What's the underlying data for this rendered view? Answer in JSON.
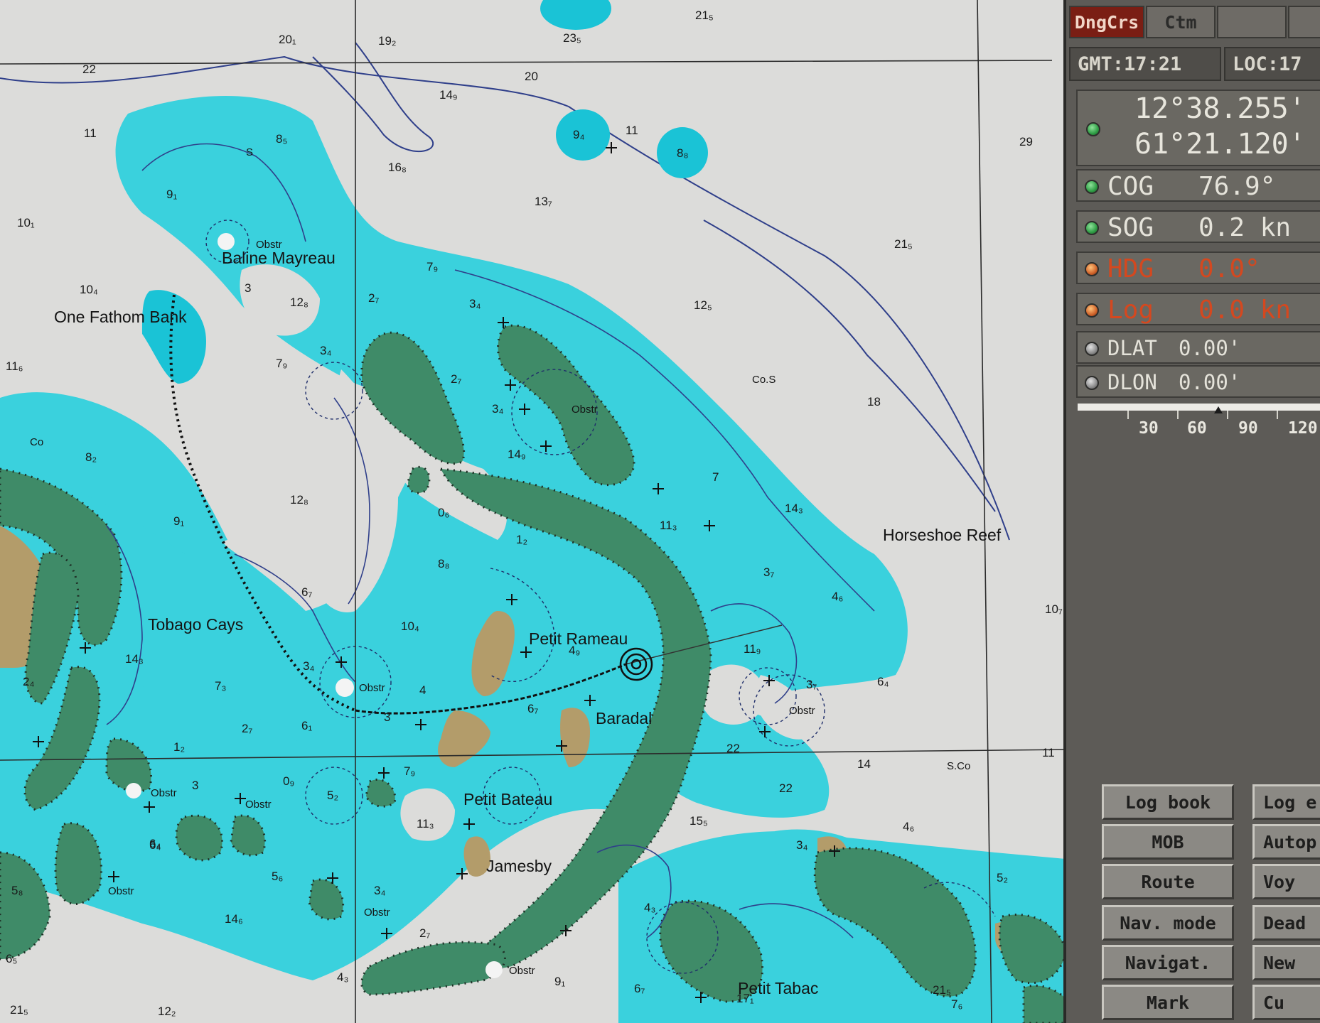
{
  "panel": {
    "tabs": {
      "dngcrs": "DngCrs",
      "ctm": "Ctm"
    },
    "gmt": "GMT:17:21",
    "loc": "LOC:17",
    "position": {
      "lat": "12°38.255'",
      "lon": "61°21.120'"
    },
    "cog": {
      "label": "COG",
      "value": "76.9°"
    },
    "sog": {
      "label": "SOG",
      "value": "0.2 kn"
    },
    "hdg": {
      "label": "HDG",
      "value": "0.0°"
    },
    "log": {
      "label": "Log",
      "value": "0.0 kn"
    },
    "dlat": {
      "label": "DLAT",
      "value": "0.00'"
    },
    "dlon": {
      "label": "DLON",
      "value": "0.00'"
    },
    "scale_ticks": [
      "30",
      "60",
      "90",
      "120"
    ],
    "buttons_left": [
      "Log book",
      "MOB",
      "Route",
      "Nav. mode",
      "Navigat.",
      "Mark"
    ],
    "buttons_right": [
      "Log e",
      "Autop",
      "Voy",
      "Dead",
      "New",
      "Cu"
    ],
    "led_colors": {
      "green": "#2f9d45",
      "amber": "#d0632a",
      "grey": "#8c8c8c"
    }
  },
  "chart": {
    "places": {
      "baline": "Baline Mayreau",
      "one_fathom": "One Fathom Bank",
      "tobago": "Tobago Cays",
      "petit_rameau": "Petit Rameau",
      "baradal": "Baradal",
      "petit_bateau": "Petit Bateau",
      "jamesby": "Jamesby",
      "petit_tabac": "Petit Tabac",
      "horseshoe": "Horseshoe Reef"
    },
    "notes": {
      "cos": "Co.S",
      "sco": "S.Co",
      "co": "Co",
      "s": "S",
      "obstr": "Obstr"
    },
    "soundings": [
      "20₁",
      "19₂",
      "21₅",
      "23₅",
      "22",
      "20",
      "11",
      "8₅",
      "14₉",
      "9₄",
      "11",
      "8₈",
      "29",
      "16₈",
      "13₇",
      "9₁",
      "10₁",
      "21₅",
      "10₄",
      "12₈",
      "2₇",
      "7₉",
      "3₄",
      "12₅",
      "11₆",
      "7₉",
      "3₄",
      "2₇",
      "3₄",
      "14₉",
      "18",
      "8₂",
      "12₈",
      "9₁",
      "0₆",
      "1₂",
      "11₃",
      "7",
      "14₃",
      "8₈",
      "6₇",
      "10₄",
      "4₉",
      "3₇",
      "4₆",
      "10₇",
      "14₃",
      "2₄",
      "7₃",
      "3₄",
      "6₇",
      "6₁",
      "2₇",
      "1₂",
      "7₉",
      "11₉",
      "3₇",
      "6₄",
      "11",
      "14",
      "22",
      "22",
      "6₄",
      "0₉",
      "5₂",
      "11₃",
      "15₅",
      "4₆",
      "5₂",
      "3₄",
      "6₄",
      "5₆",
      "3₄",
      "14₆",
      "4₃",
      "2₇",
      "4₃",
      "9₁",
      "6₇",
      "17₁",
      "7₆",
      "21₅",
      "12₂",
      "6₅",
      "5₈",
      "3",
      "3",
      "21₅",
      "3",
      "4"
    ]
  }
}
